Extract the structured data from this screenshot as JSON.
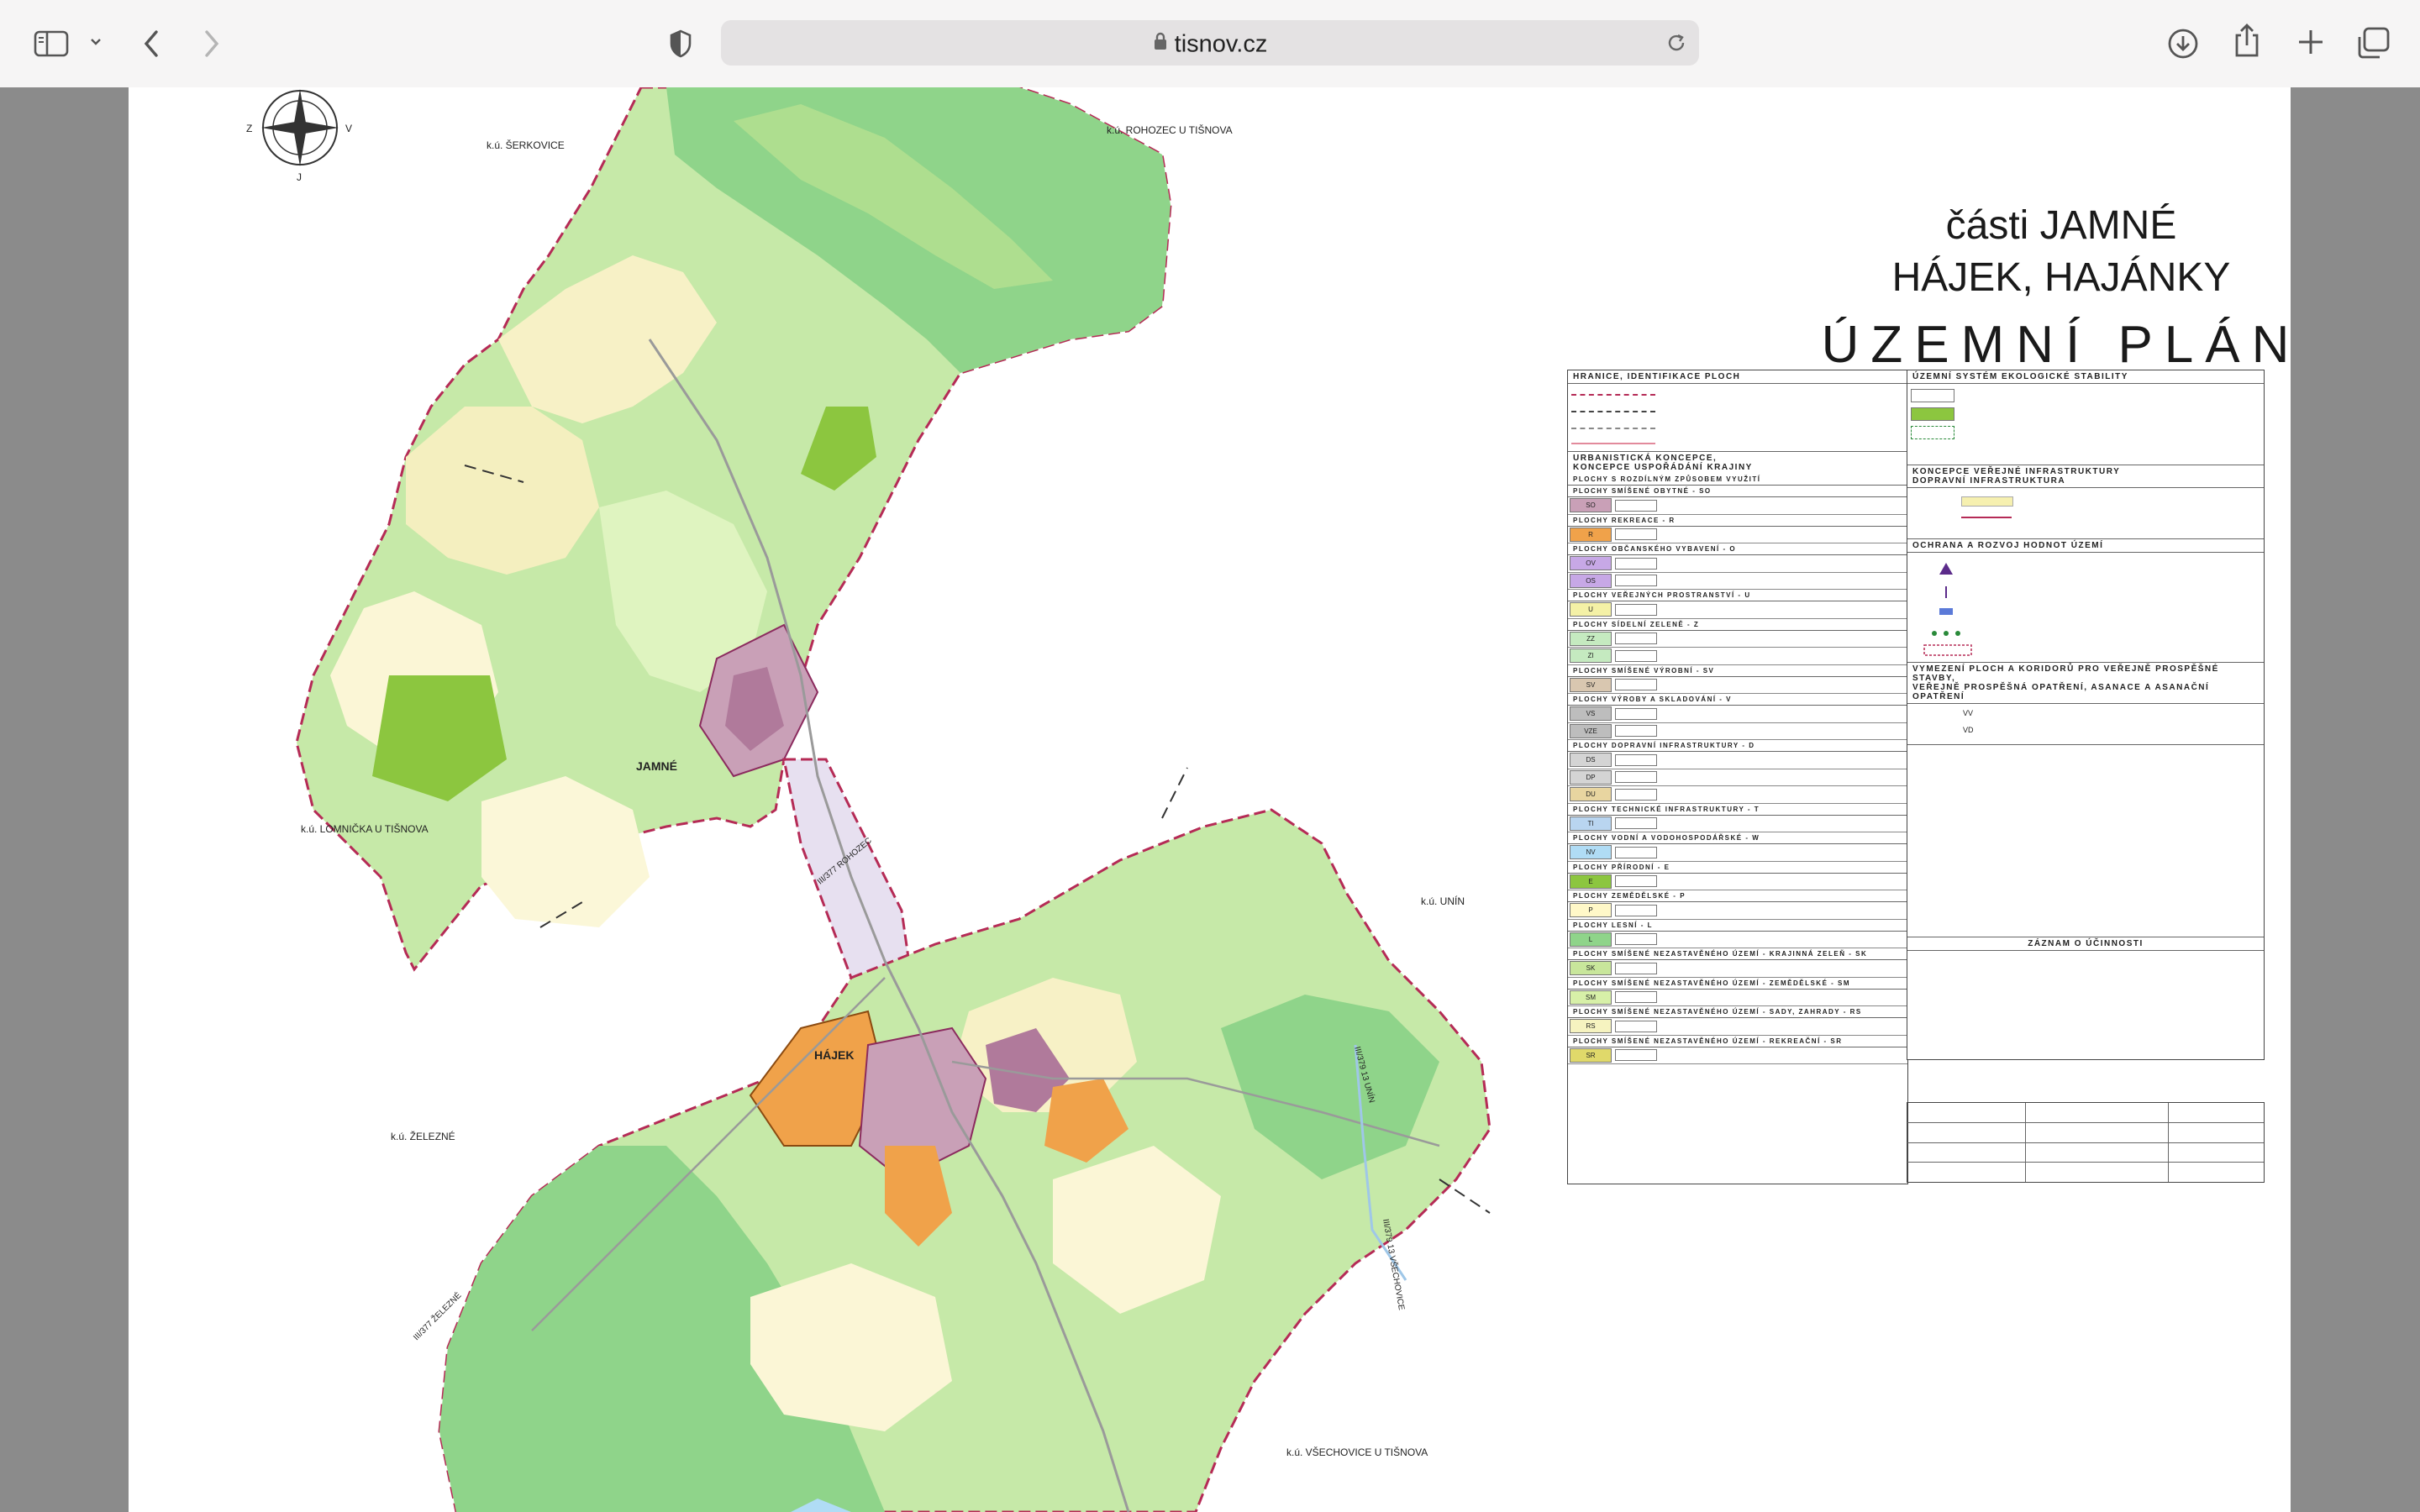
{
  "browser": {
    "url": "tisnov.cz",
    "icons": {
      "sidebar": "sidebar-icon",
      "chevron": "chevron-down-icon",
      "back": "back-arrow-icon",
      "forward": "forward-arrow-icon",
      "shield": "privacy-shield-icon",
      "lock": "lock-icon",
      "reload": "reload-icon",
      "download": "download-icon",
      "share": "share-icon",
      "newtab": "plus-icon",
      "tabs": "tab-overview-icon"
    }
  },
  "document": {
    "title_line1": "části  JAMNÉ",
    "title_line2": "HÁJEK, HAJÁNKY",
    "title_line3": "ÚZEMNÍ PLÁN",
    "compass": {
      "z": "Z",
      "v": "V",
      "j": "J"
    },
    "map_labels": {
      "serkovice": "k.ú. ŠERKOVICE",
      "rohozec": "k.ú. ROHOZEC U TIŠNOVA",
      "lomnicka": "k.ú. LOMNIČKA U TIŠNOVA",
      "unin": "k.ú. UNÍN",
      "zelezne": "k.ú. ŽELEZNÉ",
      "vsechovice": "k.ú. VŠECHOVICE U TIŠNOVA",
      "jamne": "JAMNÉ",
      "hajek": "HÁJEK",
      "road_rohozec": "III/377 ROHOZEC",
      "road_zelezne": "III/377 ŽELEZNÉ",
      "road_unin": "III/379 13 UNÍN",
      "road_vsechovice": "III/379 13 VŠECHOVICE"
    },
    "legend_left": {
      "h1": "HRANICE, IDENTIFIKACE PLOCH",
      "h2": "URBANISTICKÁ KONCEPCE,",
      "h2b": "KONCEPCE USPOŘÁDÁNÍ KRAJINY",
      "h3": "PLOCHY S ROZDÍLNÝM ZPŮSOBEM VYUŽITÍ",
      "rows": [
        {
          "code": "SO",
          "label": "PLOCHY SMÍŠENÉ OBYTNÉ - SO",
          "color": "#c9a0b7"
        },
        {
          "code": "R",
          "label": "PLOCHY REKREACE - R",
          "color": "#f0a24a"
        },
        {
          "code": "OV",
          "label": "PLOCHY OBČANSKÉHO VYBAVENÍ - O",
          "color": "#c7a8e6"
        },
        {
          "code": "OS",
          "label": "",
          "color": "#c7a8e6"
        },
        {
          "code": "U",
          "label": "PLOCHY VEŘEJNÝCH PROSTRANSTVÍ - U",
          "color": "#f4f1a6"
        },
        {
          "code": "ZZ",
          "label": "PLOCHY SÍDELNÍ ZELENĚ - Z",
          "color": "#c5eac0"
        },
        {
          "code": "ZI",
          "label": "",
          "color": "#c5eac0"
        },
        {
          "code": "SV",
          "label": "PLOCHY SMÍŠENÉ VÝROBNÍ - SV",
          "color": "#d9c7b0"
        },
        {
          "code": "VS",
          "label": "PLOCHY VÝROBY A SKLADOVÁNÍ - V",
          "color": "#bdbdbd"
        },
        {
          "code": "VZE",
          "label": "",
          "color": "#bdbdbd"
        },
        {
          "code": "DS",
          "label": "PLOCHY DOPRAVNÍ INFRASTRUKTURY - D",
          "color": "#d4d4d4"
        },
        {
          "code": "DP",
          "label": "",
          "color": "#d4d4d4"
        },
        {
          "code": "DU",
          "label": "",
          "color": "#e8d5a0"
        },
        {
          "code": "TI",
          "label": "PLOCHY TECHNICKÉ INFRASTRUKTURY - T",
          "color": "#b9d5f0"
        },
        {
          "code": "NV",
          "label": "PLOCHY VODNÍ A VODOHOSPODÁŘSKÉ - W",
          "color": "#b0dcf5"
        },
        {
          "code": "E",
          "label": "PLOCHY PŘÍRODNÍ - E",
          "color": "#8cc63f"
        },
        {
          "code": "P",
          "label": "PLOCHY ZEMĚDĚLSKÉ - P",
          "color": "#fff8c8"
        },
        {
          "code": "L",
          "label": "PLOCHY LESNÍ - L",
          "color": "#8fd48a"
        },
        {
          "code": "SK",
          "label": "PLOCHY SMÍŠENÉ NEZASTAVĚNÉHO ÚZEMÍ - KRAJINNÁ ZELEŇ - SK",
          "color": "#c8e69b"
        },
        {
          "code": "SM",
          "label": "PLOCHY SMÍŠENÉ NEZASTAVĚNÉHO ÚZEMÍ - ZEMĚDĚLSKÉ - SM",
          "color": "#d7f0a8"
        },
        {
          "code": "RS",
          "label": "PLOCHY SMÍŠENÉ NEZASTAVĚNÉHO ÚZEMÍ - SADY, ZAHRADY - RS",
          "color": "#f6f3c0"
        },
        {
          "code": "SR",
          "label": "PLOCHY SMÍŠENÉ NEZASTAVĚNÉHO ÚZEMÍ - REKREAČNÍ - SR",
          "color": "#e0d96a"
        }
      ]
    },
    "legend_right": {
      "h1": "ÚZEMNÍ SYSTÉM EKOLOGICKÉ STABILITY",
      "h2": "KONCEPCE VEŘEJNÉ INFRASTRUKTURY",
      "h2b": "DOPRAVNÍ INFRASTRUKTURA",
      "h3": "OCHRANA A ROZVOJ HODNOT ÚZEMÍ",
      "h4": "VYMEZENÍ PLOCH A KORIDORŮ PRO VEŘEJNĚ PROSPĚŠNÉ STAVBY,",
      "h4b": "VEŘEJNĚ PROSPĚŠNÁ OPATŘENÍ, ASANACE A ASANAČNÍ OPATŘENÍ",
      "vp1": "VV",
      "vp2": "VD",
      "h5": "ZÁZNAM O ÚČINNOSTI"
    }
  }
}
